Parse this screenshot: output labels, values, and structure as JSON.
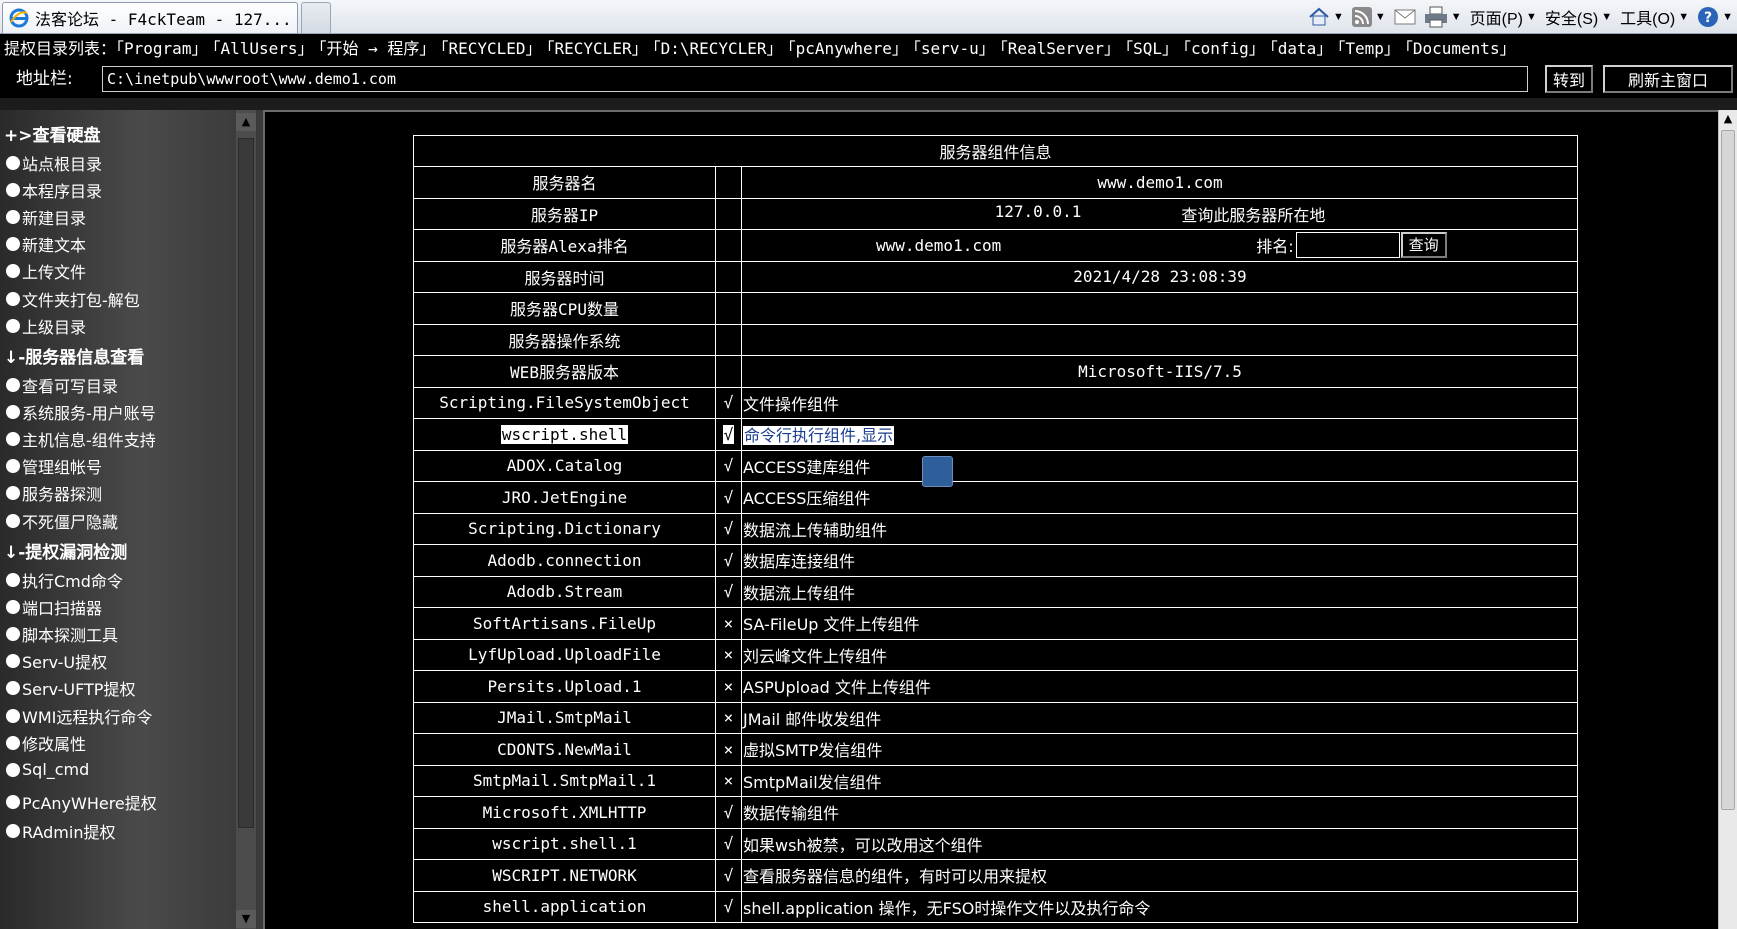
{
  "browser": {
    "tab_title": "法客论坛 - F4ckTeam - 127...",
    "commands": {
      "page_label": "页面(P)",
      "safety_label": "安全(S)",
      "tools_label": "工具(O)"
    }
  },
  "dirlist": {
    "label": "提权目录列表：",
    "links": [
      "「Program」",
      "「AllUsers」",
      "「开始 → 程序」",
      "「RECYCLED」",
      "「RECYCLER」",
      "「D:\\RECYCLER」",
      "「pcAnywhere」",
      "「serv-u」",
      "「RealServer」",
      "「SQL」",
      "「config」",
      "「data」",
      "「Temp」",
      "「Documents」"
    ]
  },
  "address": {
    "label": "地址栏:",
    "value": "C:\\inetpub\\wwwroot\\www.demo1.com",
    "go_label": "转到",
    "refresh_label": "刷新主窗口"
  },
  "sidebar": {
    "sections": [
      {
        "title": "+>查看硬盘",
        "items": [
          "站点根目录",
          "本程序目录",
          "新建目录",
          "新建文本",
          "上传文件",
          "文件夹打包-解包",
          "上级目录"
        ]
      },
      {
        "title": "↓-服务器信息查看",
        "items": [
          "查看可写目录",
          "系统服务-用户账号",
          "主机信息-组件支持",
          "管理组帐号",
          "服务器探测",
          "不死僵尸隐藏"
        ]
      },
      {
        "title": "↓-提权漏洞检测",
        "items": [
          "执行Cmd命令",
          "端口扫描器",
          "脚本探测工具",
          "Serv-U提权",
          "Serv-UFTP提权",
          "WMI远程执行命令",
          "修改属性",
          "Sql_cmd",
          "PcAnyWHere提权",
          "RAdmin提权"
        ]
      }
    ]
  },
  "server_info": {
    "title": "服务器组件信息",
    "rows": [
      {
        "label": "服务器名",
        "value": "www.demo1.com"
      },
      {
        "label": "服务器IP",
        "value": "127.0.0.1",
        "extra": "查询此服务器所在地"
      },
      {
        "label": "服务器Alexa排名",
        "value": "www.demo1.com",
        "rank_label": "排名:",
        "query_label": "查询"
      },
      {
        "label": "服务器时间",
        "value": "2021/4/28 23:08:39"
      },
      {
        "label": "服务器CPU数量",
        "value": ""
      },
      {
        "label": "服务器操作系统",
        "value": ""
      },
      {
        "label": "WEB服务器版本",
        "value": "Microsoft-IIS/7.5"
      }
    ],
    "components": [
      {
        "name": "Scripting.FileSystemObject",
        "status": "√",
        "ok": true,
        "desc": "文件操作组件"
      },
      {
        "name": "wscript.shell",
        "status": "√",
        "ok": true,
        "desc": "命令行执行组件,显示",
        "selected": true
      },
      {
        "name": "ADOX.Catalog",
        "status": "√",
        "ok": true,
        "desc": "ACCESS建库组件"
      },
      {
        "name": "JRO.JetEngine",
        "status": "√",
        "ok": true,
        "desc": "ACCESS压缩组件"
      },
      {
        "name": "Scripting.Dictionary",
        "status": "√",
        "ok": true,
        "desc": "数据流上传辅助组件"
      },
      {
        "name": "Adodb.connection",
        "status": "√",
        "ok": true,
        "desc": "数据库连接组件"
      },
      {
        "name": "Adodb.Stream",
        "status": "√",
        "ok": true,
        "desc": "数据流上传组件"
      },
      {
        "name": "SoftArtisans.FileUp",
        "status": "×",
        "ok": false,
        "desc": "SA-FileUp 文件上传组件"
      },
      {
        "name": "LyfUpload.UploadFile",
        "status": "×",
        "ok": false,
        "desc": "刘云峰文件上传组件"
      },
      {
        "name": "Persits.Upload.1",
        "status": "×",
        "ok": false,
        "desc": "ASPUpload 文件上传组件"
      },
      {
        "name": "JMail.SmtpMail",
        "status": "×",
        "ok": false,
        "desc": "JMail 邮件收发组件"
      },
      {
        "name": "CDONTS.NewMail",
        "status": "×",
        "ok": false,
        "desc": "虚拟SMTP发信组件"
      },
      {
        "name": "SmtpMail.SmtpMail.1",
        "status": "×",
        "ok": false,
        "desc": "SmtpMail发信组件"
      },
      {
        "name": "Microsoft.XMLHTTP",
        "status": "√",
        "ok": true,
        "desc": "数据传输组件"
      },
      {
        "name": "wscript.shell.1",
        "status": "√",
        "ok": true,
        "desc": "如果wsh被禁，可以改用这个组件"
      },
      {
        "name": "WSCRIPT.NETWORK",
        "status": "√",
        "ok": true,
        "desc": "查看服务器信息的组件，有时可以用来提权"
      },
      {
        "name": "shell.application",
        "status": "√",
        "ok": true,
        "desc": "shell.application 操作，无FSO时操作文件以及执行命令"
      }
    ]
  },
  "colors": {
    "ok": "#ffffff",
    "fail": "#d00000",
    "background": "#000000",
    "sidebar": "#3c3c3c"
  }
}
